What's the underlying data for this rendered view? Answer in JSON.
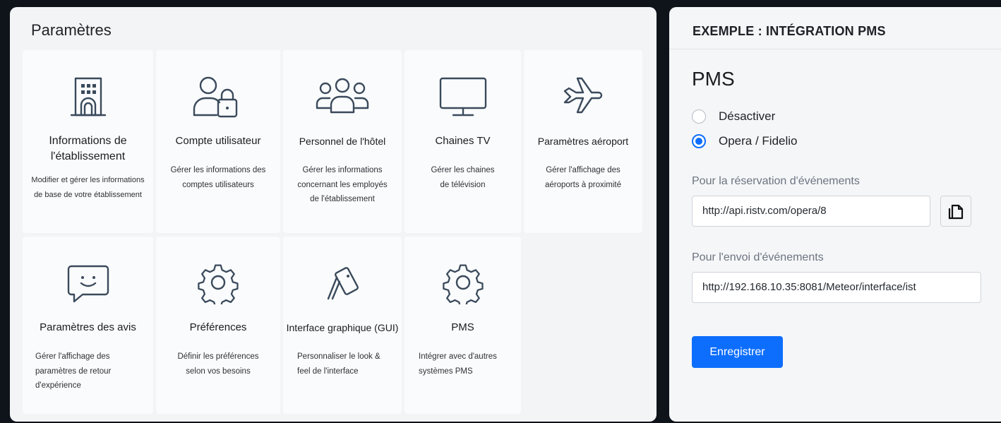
{
  "settings": {
    "title": "Paramètres",
    "cards": [
      {
        "name": "Informations de l'établissement",
        "desc": "Modifier et gérer les informations de base de votre établissement",
        "icon": "building-icon"
      },
      {
        "name": "Compte utilisateur",
        "desc": "Gérer les informations des comptes utilisateurs",
        "icon": "user-lock-icon"
      },
      {
        "name": "Personnel de l'hôtel",
        "desc": "Gérer les informations concernant les employés de l'établissement",
        "icon": "users-icon"
      },
      {
        "name": "Chaines TV",
        "desc": "Gérer les chaines de télévision",
        "icon": "tv-icon"
      },
      {
        "name": "Paramètres aéroport",
        "desc": "Gérer l'affichage des aéroports à proximité",
        "icon": "airplane-icon"
      },
      {
        "name": "Paramètres des avis",
        "desc": "Gérer l'affichage des paramètres de retour d'expérience",
        "icon": "feedback-icon"
      },
      {
        "name": "Préférences",
        "desc": "Définir les préférences selon vos besoins",
        "icon": "gear-icon"
      },
      {
        "name": "Interface graphique (GUI)",
        "desc": "Personnaliser le look & feel de l'interface",
        "icon": "palette-cards-icon"
      },
      {
        "name": "PMS",
        "desc": "Intégrer avec d'autres systèmes PMS",
        "icon": "gear-icon"
      }
    ]
  },
  "example": {
    "header": "EXEMPLE : INTÉGRATION PMS",
    "title": "PMS",
    "options": [
      {
        "label": "Désactiver",
        "selected": false
      },
      {
        "label": "Opera / Fidelio",
        "selected": true
      }
    ],
    "reservation_label": "Pour la réservation d'événements",
    "reservation_url": "http://api.ristv.com/opera/8",
    "send_label": "Pour l'envoi d'événements",
    "send_url": "http://192.168.10.35:8081/Meteor/interface/ist",
    "save_label": "Enregistrer",
    "accent_color": "#0d6efd"
  }
}
